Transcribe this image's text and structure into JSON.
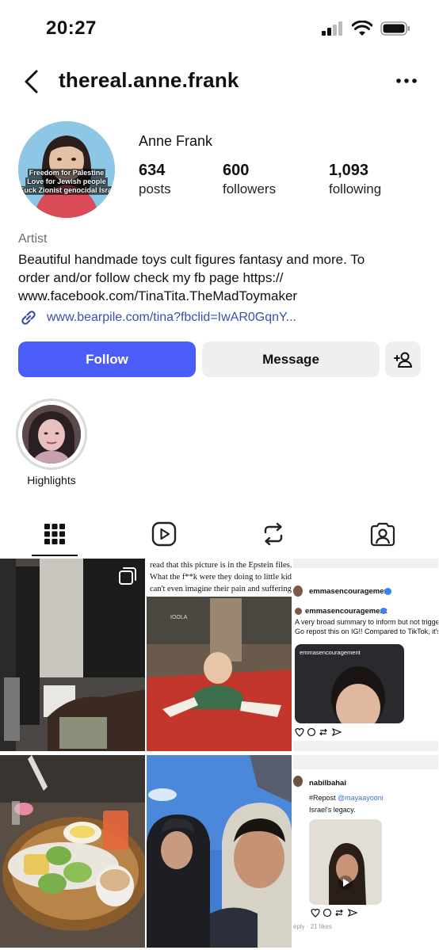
{
  "status_bar": {
    "time": "20:27"
  },
  "header": {
    "username": "thereal.anne.frank"
  },
  "profile": {
    "display_name": "Anne Frank",
    "avatar_overlay": [
      "Freedom for Palestine",
      "Love for Jewish people",
      "Fuck Zionist genocidal Israel"
    ],
    "stats": [
      {
        "value": "634",
        "label": "posts"
      },
      {
        "value": "600",
        "label": "followers"
      },
      {
        "value": "1,093",
        "label": "following"
      }
    ],
    "category": "Artist",
    "bio_lines": [
      "Beautiful handmade toys cult figures fantasy and more. To",
      "order and/or follow check my fb page https://",
      "www.facebook.com/TinaTita.TheMadToymaker"
    ],
    "link": "www.bearpile.com/tina?fbclid=IwAR0GqnY..."
  },
  "actions": {
    "follow_label": "Follow",
    "message_label": "Message"
  },
  "highlights": [
    {
      "label": "Highlights"
    }
  ],
  "tabs": [
    "grid-icon",
    "reels-icon",
    "reposts-icon",
    "tagged-icon"
  ],
  "grid": {
    "post_epstein": {
      "lines": [
        "read that this picture is in the Epstein files.",
        "What the f**k were they doing to little kids?",
        "can't even imagine their pain and suffering."
      ],
      "sign_text": "IOOLA"
    },
    "post_emmas": {
      "header_handle": "emmasencouragement",
      "inner_handle": "emmasencouragement",
      "lines": [
        "A very broad summary to inform but not trigger.",
        "Go repost this on IG!! Compared to TikTok, it's..."
      ],
      "video_handle": "emmasencouragement"
    },
    "post_nabil": {
      "handle": "nabilbahai",
      "repost_prefix": "#Repost",
      "repost_handle": "@mayaayooni",
      "caption": "Israel's legacy.",
      "footer": "eply · 21 likes"
    }
  },
  "colors": {
    "accent": "#4a5df9",
    "link": "#3a4fb0",
    "button_gray": "#efeff2"
  }
}
